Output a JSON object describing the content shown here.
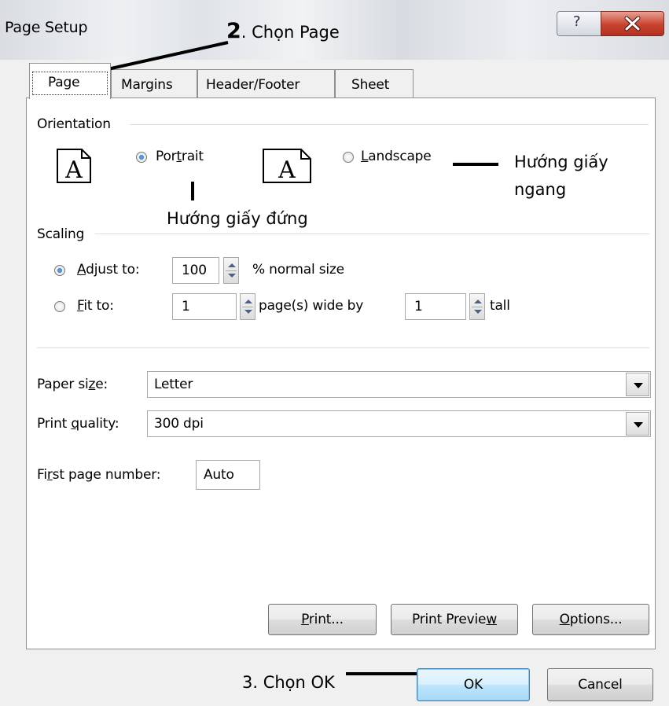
{
  "window": {
    "title": "Page Setup",
    "help_icon": "question-icon",
    "close_icon": "close-x-icon"
  },
  "tabs": [
    {
      "label": "Page",
      "active": true
    },
    {
      "label": "Margins",
      "active": false
    },
    {
      "label": "Header/Footer",
      "active": false
    },
    {
      "label": "Sheet",
      "active": false
    }
  ],
  "orientation": {
    "group_label": "Orientation",
    "portrait": {
      "label_pre": "Por",
      "label_key": "t",
      "label_post": "rait",
      "selected": true,
      "icon": "portrait-page-icon",
      "glyph": "A"
    },
    "landscape": {
      "label_pre": "",
      "label_key": "L",
      "label_post": "andscape",
      "selected": false,
      "icon": "landscape-page-icon",
      "glyph": "A"
    }
  },
  "scaling": {
    "group_label": "Scaling",
    "adjust": {
      "label_key": "A",
      "label_post": "djust to:",
      "value": "100",
      "suffix": "% normal size",
      "selected": true
    },
    "fit": {
      "label_key": "F",
      "label_post": "it to:",
      "wide_value": "1",
      "wide_suffix": "page(s) wide by",
      "tall_value": "1",
      "tall_suffix": "tall",
      "selected": false
    }
  },
  "paper_size": {
    "label_pre": "Paper si",
    "label_key": "z",
    "label_post": "e:",
    "value": "Letter"
  },
  "print_quality": {
    "label_pre": "Print ",
    "label_key": "q",
    "label_post": "uality:",
    "value": "300 dpi"
  },
  "first_page": {
    "label_pre": "Fi",
    "label_key": "r",
    "label_post": "st page number:",
    "value": "Auto"
  },
  "buttons": {
    "print": {
      "key": "P",
      "post": "rint..."
    },
    "preview": {
      "pre": "Print Previe",
      "key": "w"
    },
    "options": {
      "key": "O",
      "post": "ptions..."
    },
    "ok": "OK",
    "cancel": "Cancel"
  },
  "annotations": {
    "choose_page_num": "2",
    "choose_page_text": ". Chọn Page",
    "portrait_note": "Hướng giấy đứng",
    "landscape_note_1": "Hướng giấy",
    "landscape_note_2": "ngang",
    "choose_ok": "3. Chọn OK"
  }
}
